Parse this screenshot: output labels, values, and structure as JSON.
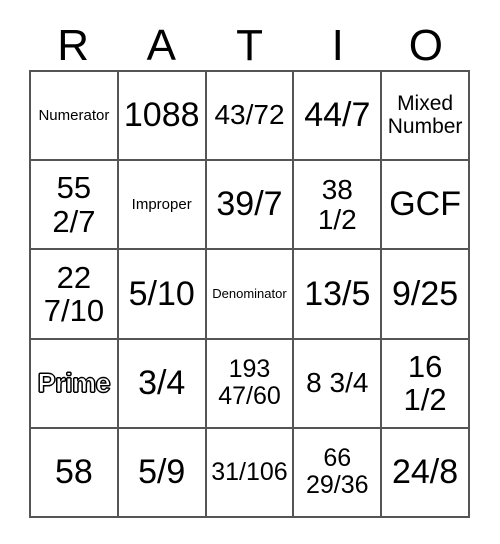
{
  "card": {
    "title": "RATIO",
    "header_letters": [
      "R",
      "A",
      "T",
      "I",
      "O"
    ],
    "colors": {
      "background": "#ffffff",
      "text": "#000000",
      "grid_line": "#555555"
    },
    "rows": 5,
    "columns": 5,
    "cells": [
      [
        {
          "text": "Numerator",
          "size": "fs-xs",
          "style": "plain"
        },
        {
          "text": "1088",
          "size": "fs-xxl",
          "style": "plain"
        },
        {
          "text": "43/72",
          "size": "fs-lg",
          "style": "plain"
        },
        {
          "text": "44/7",
          "size": "fs-xxl",
          "style": "plain"
        },
        {
          "text": "Mixed\nNumber",
          "size": "fs-sm",
          "style": "plain"
        }
      ],
      [
        {
          "text": "55\n2/7",
          "size": "fs-xl",
          "style": "plain"
        },
        {
          "text": "Improper",
          "size": "fs-xs",
          "style": "plain"
        },
        {
          "text": "39/7",
          "size": "fs-xxl",
          "style": "plain"
        },
        {
          "text": "38\n1/2",
          "size": "fs-lg",
          "style": "plain"
        },
        {
          "text": "GCF",
          "size": "fs-xxl",
          "style": "plain"
        }
      ],
      [
        {
          "text": "22\n7/10",
          "size": "fs-xl",
          "style": "plain"
        },
        {
          "text": "5/10",
          "size": "fs-xxl",
          "style": "plain"
        },
        {
          "text": "Denominator",
          "size": "fs-xxs",
          "style": "plain"
        },
        {
          "text": "13/5",
          "size": "fs-xxl",
          "style": "plain"
        },
        {
          "text": "9/25",
          "size": "fs-xxl",
          "style": "plain"
        }
      ],
      [
        {
          "text": "Prime",
          "size": "fs-md",
          "style": "outline"
        },
        {
          "text": "3/4",
          "size": "fs-xxl",
          "style": "plain"
        },
        {
          "text": "193\n47/60",
          "size": "fs-md",
          "style": "plain"
        },
        {
          "text": "8 3/4",
          "size": "fs-lg",
          "style": "plain"
        },
        {
          "text": "16\n1/2",
          "size": "fs-xl",
          "style": "plain"
        }
      ],
      [
        {
          "text": "58",
          "size": "fs-xxl",
          "style": "plain"
        },
        {
          "text": "5/9",
          "size": "fs-xxl",
          "style": "plain"
        },
        {
          "text": "31/106",
          "size": "fs-md",
          "style": "plain"
        },
        {
          "text": "66\n29/36",
          "size": "fs-md",
          "style": "plain"
        },
        {
          "text": "24/8",
          "size": "fs-xxl",
          "style": "plain"
        }
      ]
    ]
  }
}
